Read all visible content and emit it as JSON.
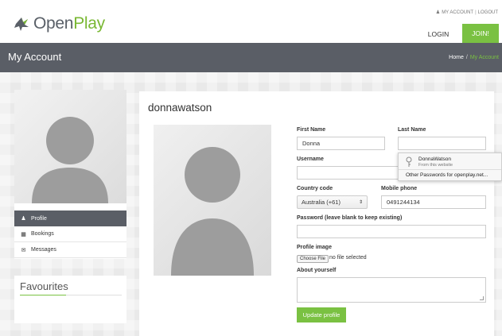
{
  "header": {
    "logo_text_open": "Open",
    "logo_text_play": "Play",
    "my_account_link": "MY ACCOUNT",
    "logout_link": "LOGOUT",
    "login_label": "LOGIN",
    "join_label": "JOIN!",
    "accent_color": "#7ac142"
  },
  "titlebar": {
    "title": "My Account",
    "breadcrumb_home": "Home",
    "breadcrumb_sep": "/",
    "breadcrumb_current": "My Account"
  },
  "sidebar": {
    "menu": [
      {
        "label": "Profile",
        "icon": "user-icon",
        "active": true
      },
      {
        "label": "Bookings",
        "icon": "calendar-icon",
        "active": false
      },
      {
        "label": "Messages",
        "icon": "envelope-icon",
        "active": false
      }
    ],
    "favourites_title": "Favourites"
  },
  "profile": {
    "username": "donnawatson",
    "first_name_label": "First Name",
    "first_name_value": "Donna",
    "last_name_label": "Last Name",
    "last_name_value": "",
    "username_label": "Username",
    "username_value": "",
    "country_code_label": "Country code",
    "country_code_value": "Australia (+61)",
    "mobile_label": "Mobile phone",
    "mobile_value": "0491244134",
    "password_label": "Password (leave blank to keep existing)",
    "password_value": "",
    "profile_image_label": "Profile image",
    "choose_file_label": "Choose File",
    "no_file_text": "no file selected",
    "about_label": "About yourself",
    "about_value": "",
    "update_button": "Update profile"
  },
  "autofill": {
    "saved_user": "DonnaWatson",
    "from_text": "From this website",
    "other_passwords": "Other Passwords for openplay.net..."
  }
}
